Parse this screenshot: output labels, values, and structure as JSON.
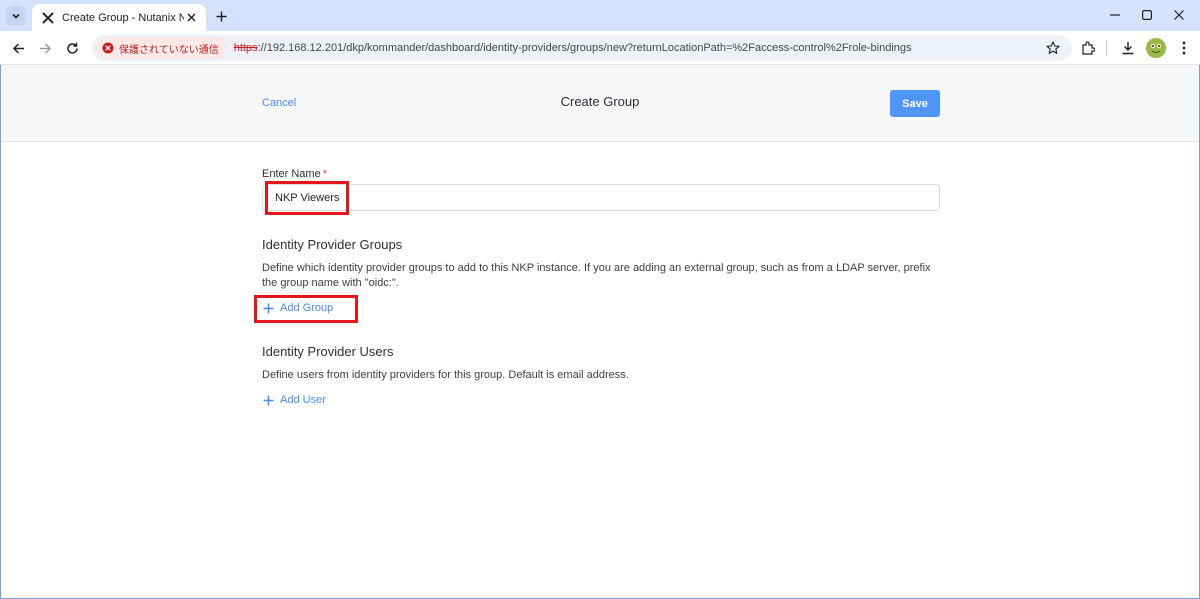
{
  "browser": {
    "tab_title": "Create Group - Nutanix NKP",
    "security_chip": "保護されていない通信",
    "url_scheme": "https",
    "url_rest": "://192.168.12.201/dkp/kommander/dashboard/identity-providers/groups/new?returnLocationPath=%2Faccess-control%2Frole-bindings",
    "colors": {
      "tabbar": "#d3e3fd",
      "insecure": "#c5221f"
    }
  },
  "header": {
    "cancel_label": "Cancel",
    "title": "Create Group",
    "save_label": "Save"
  },
  "form": {
    "name_label": "Enter Name",
    "required_mark": "*",
    "name_value": "NKP Viewers"
  },
  "groups_section": {
    "title": "Identity Provider Groups",
    "description": "Define which identity provider groups to add to this NKP instance. If you are adding an external group, such as from a LDAP server, prefix the group name with \"oidc:\".",
    "add_label": "Add Group"
  },
  "users_section": {
    "title": "Identity Provider Users",
    "description": "Define users from identity providers for this group. Default is email address.",
    "add_label": "Add User"
  },
  "accent_color": "#4a87f5",
  "highlight_color": "#e3161b"
}
